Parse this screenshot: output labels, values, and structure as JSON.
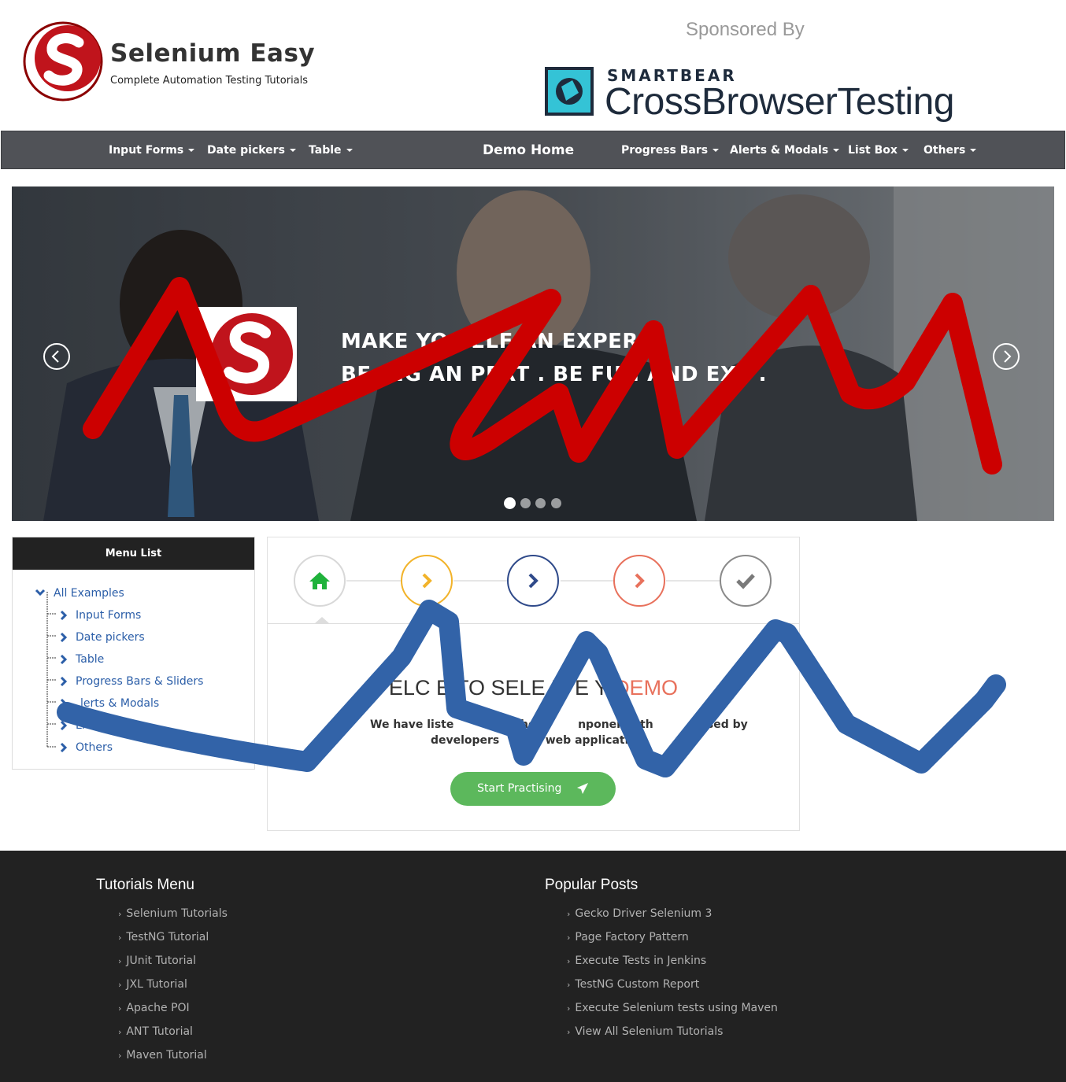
{
  "header": {
    "brand_name": "Selenium Easy",
    "brand_tagline": "Complete Automation Testing Tutorials",
    "sponsor_label": "Sponsored By",
    "sponsor_brand": "SMARTBEAR",
    "sponsor_product": "CrossBrowserTesting"
  },
  "nav": {
    "input_forms": "Input Forms",
    "date_pickers": "Date pickers",
    "table": "Table",
    "demo_home": "Demo Home",
    "progress_bars": "Progress Bars",
    "alerts_modals": "Alerts & Modals",
    "list_box": "List Box",
    "others": "Others"
  },
  "carousel": {
    "line1": "MAKE YO    SELF   AN EXPER",
    "line2": "BE    ING AN    PERT       . BE FUN    AND EXC      .",
    "slide_count": 4,
    "active_slide": 1
  },
  "sidebar": {
    "title": "Menu List",
    "root": "All Examples",
    "items": [
      "Input Forms",
      "Date pickers",
      "Table",
      "Progress Bars & Sliders",
      "lerts & Modals",
      "Li",
      "Others"
    ]
  },
  "main": {
    "welcome_text": "ELC    E TO SELE      M E    Y ",
    "welcome_highlight": "DEMO",
    "intro_line1": "We have liste                the           nponents th         e used by",
    "intro_line2": "developers            web applicatio",
    "start_button": "Start Practising",
    "steps": [
      {
        "icon": "home-icon",
        "color": "#1fb23b"
      },
      {
        "icon": "chevron-right-icon",
        "color": "#f2b32a"
      },
      {
        "icon": "chevron-right-icon",
        "color": "#2f4a8a"
      },
      {
        "icon": "chevron-right-icon",
        "color": "#e8715c"
      },
      {
        "icon": "check-icon",
        "color": "#8a8a8a"
      }
    ]
  },
  "footer": {
    "tutorials_title": "Tutorials Menu",
    "tutorials": [
      "Selenium Tutorials",
      "TestNG Tutorial",
      "JUnit Tutorial",
      "JXL Tutorial",
      "Apache POI",
      "ANT Tutorial",
      "Maven Tutorial"
    ],
    "popular_title": "Popular Posts",
    "popular": [
      "Gecko Driver Selenium 3",
      "Page Factory Pattern",
      "Execute Tests in Jenkins",
      "TestNG Custom Report",
      "Execute Selenium tests using Maven",
      "View All Selenium Tutorials"
    ]
  },
  "colors": {
    "navbar": "#505257",
    "accent_green": "#5cb85c",
    "link_blue": "#2b5ea8",
    "scribble_red": "#cc0000",
    "scribble_blue": "#3263a8"
  }
}
